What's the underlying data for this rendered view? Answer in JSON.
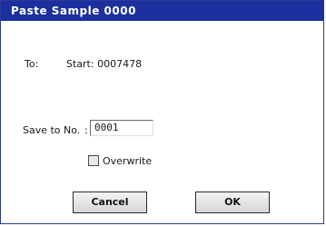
{
  "dialog": {
    "title": "Paste Sample 0000",
    "to_label": "To:",
    "start_text": "Start: 0007478",
    "save_to_label": "Save to No.",
    "colon": ":",
    "save_to_value": "0001",
    "overwrite_label": "Overwrite",
    "overwrite_checked": false,
    "cancel_label": "Cancel",
    "ok_label": "OK"
  },
  "colors": {
    "titlebar": "#1c2f9e",
    "title_text": "#ffffff",
    "border": "#2a3a9a"
  }
}
